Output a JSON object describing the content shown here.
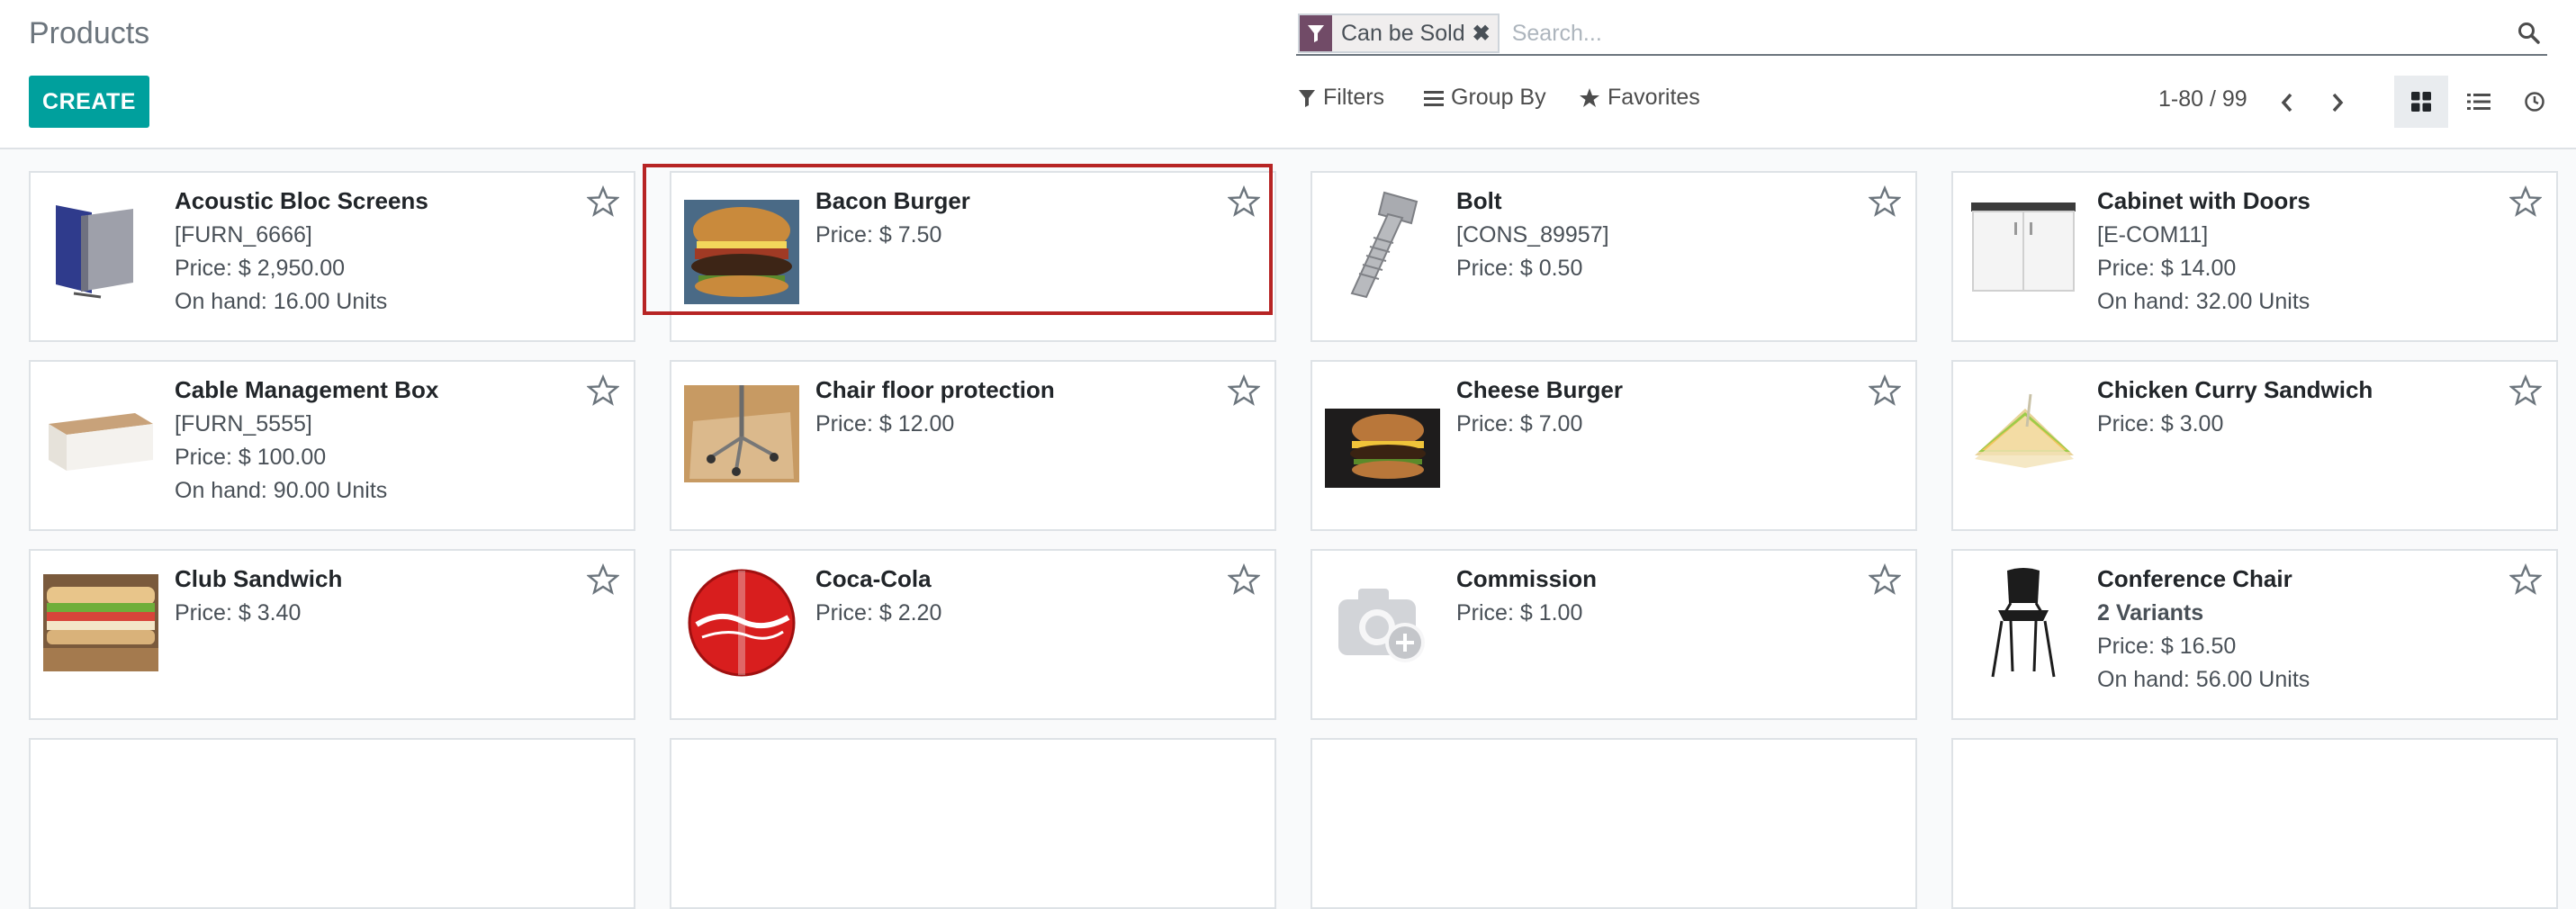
{
  "breadcrumb": {
    "title": "Products"
  },
  "toolbar": {
    "create_label": "CREATE"
  },
  "search": {
    "facet_label": "Can be Sold",
    "placeholder": "Search...",
    "value": ""
  },
  "searchpanel": {
    "filters_label": "Filters",
    "groupby_label": "Group By",
    "favorites_label": "Favorites"
  },
  "pager": {
    "value": "1-80 / 99"
  },
  "colors": {
    "primary": "#00a09d",
    "facet_icon": "#714b67",
    "highlight": "#b72424"
  },
  "products": [
    {
      "name": "Acoustic Bloc Screens",
      "ref": "[FURN_6666]",
      "price": "Price: $ 2,950.00",
      "onhand": "On hand: 16.00 Units",
      "image": "acoustic-screens-image"
    },
    {
      "name": "Bacon Burger",
      "price": "Price: $ 7.50",
      "image": "bacon-burger-image"
    },
    {
      "name": "Bolt",
      "ref": "[CONS_89957]",
      "price": "Price: $ 0.50",
      "image": "bolt-image"
    },
    {
      "name": "Cabinet with Doors",
      "ref": "[E-COM11]",
      "price": "Price: $ 14.00",
      "onhand": "On hand: 32.00 Units",
      "image": "cabinet-image"
    },
    {
      "name": "Cable Management Box",
      "ref": "[FURN_5555]",
      "price": "Price: $ 100.00",
      "onhand": "On hand: 90.00 Units",
      "image": "cable-box-image"
    },
    {
      "name": "Chair floor protection",
      "price": "Price: $ 12.00",
      "image": "floor-protection-image"
    },
    {
      "name": "Cheese Burger",
      "price": "Price: $ 7.00",
      "image": "cheese-burger-image"
    },
    {
      "name": "Chicken Curry Sandwich",
      "price": "Price: $ 3.00",
      "image": "curry-sandwich-image"
    },
    {
      "name": "Club Sandwich",
      "price": "Price: $ 3.40",
      "image": "club-sandwich-image"
    },
    {
      "name": "Coca-Cola",
      "price": "Price: $ 2.20",
      "image": "coca-cola-image"
    },
    {
      "name": "Commission",
      "price": "Price: $ 1.00",
      "image": "camera-placeholder-icon"
    },
    {
      "name": "Conference Chair",
      "variants": "2 Variants",
      "price": "Price: $ 16.50",
      "onhand": "On hand: 56.00 Units",
      "image": "conference-chair-image"
    }
  ]
}
